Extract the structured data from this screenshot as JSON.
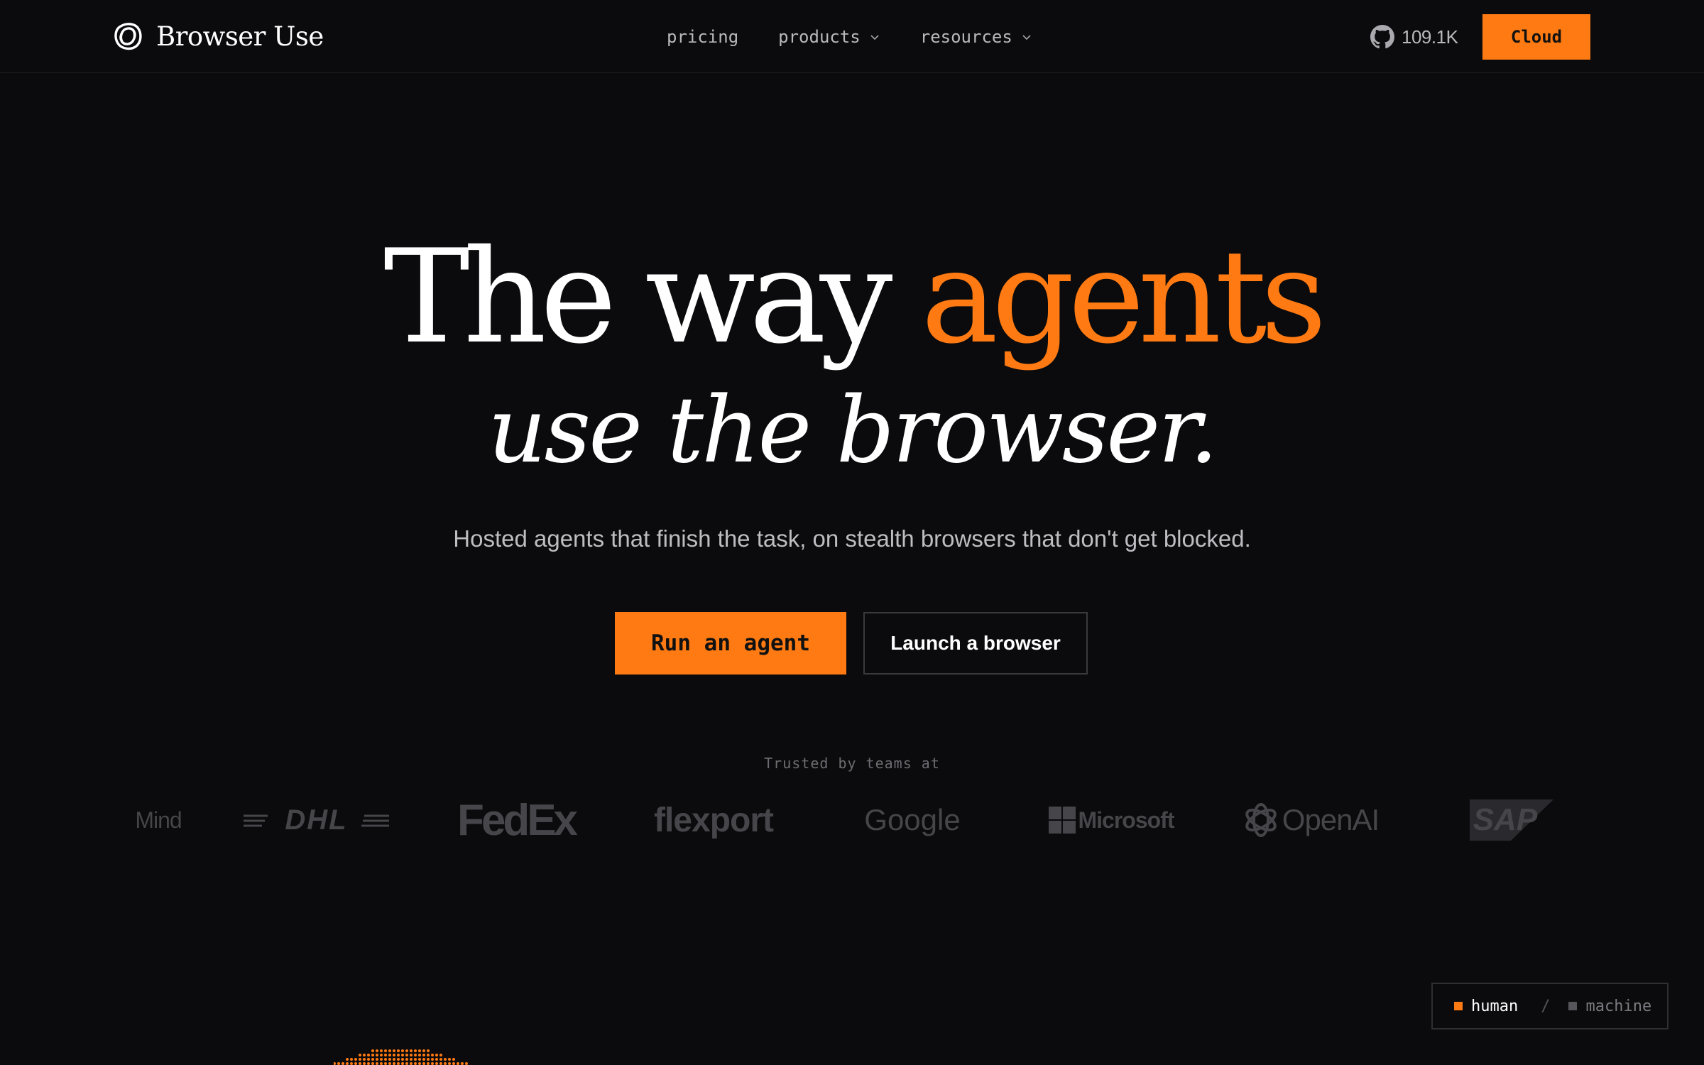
{
  "header": {
    "brand_name": "Browser Use",
    "nav": [
      {
        "label": "pricing",
        "has_dropdown": false
      },
      {
        "label": "products",
        "has_dropdown": true
      },
      {
        "label": "resources",
        "has_dropdown": true
      }
    ],
    "github_stars": "109.1K",
    "cloud_label": "Cloud"
  },
  "hero": {
    "line1_prefix": "The way ",
    "line1_accent": "agents",
    "line2": "use the browser.",
    "subtitle": "Hosted agents that finish the task, on stealth browsers that don't get blocked.",
    "cta_primary": "Run an agent",
    "cta_secondary": "Launch a browser"
  },
  "trusted": {
    "label": "Trusted by teams at",
    "logos": [
      "Mind",
      "DHL",
      "FedEx",
      "flexport",
      "Google",
      "Microsoft",
      "OpenAI",
      "SAP"
    ]
  },
  "mode_toggle": {
    "human": "human",
    "separator": "/",
    "machine": "machine",
    "selected": "human"
  },
  "colors": {
    "background": "#0b0b0d",
    "accent": "#ff7a12",
    "text": "#ffffff",
    "muted": "#bdbdc2",
    "logo_gray": "#45454a"
  },
  "icons": {
    "brand": "browser-use-logo-icon",
    "github": "github-icon",
    "dropdown": "chevron-down-icon"
  }
}
